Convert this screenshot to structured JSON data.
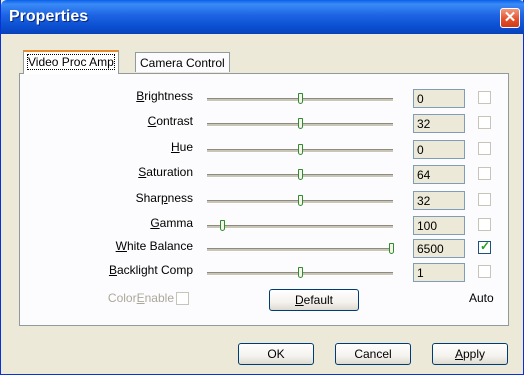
{
  "window": {
    "title": "Properties"
  },
  "tabs": [
    {
      "label": "Video Proc Amp",
      "active": true
    },
    {
      "label": "Camera Control",
      "active": false
    }
  ],
  "controls": [
    {
      "pre": "",
      "ul": "B",
      "post": "rightness",
      "value": "0",
      "level": 0.5,
      "auto": false,
      "auto_enabled": false
    },
    {
      "pre": "",
      "ul": "C",
      "post": "ontrast",
      "value": "32",
      "level": 0.5,
      "auto": false,
      "auto_enabled": false
    },
    {
      "pre": "",
      "ul": "H",
      "post": "ue",
      "value": "0",
      "level": 0.5,
      "auto": false,
      "auto_enabled": false
    },
    {
      "pre": "",
      "ul": "S",
      "post": "aturation",
      "value": "64",
      "level": 0.5,
      "auto": false,
      "auto_enabled": false
    },
    {
      "pre": "Shar",
      "ul": "p",
      "post": "ness",
      "value": "32",
      "level": 0.5,
      "auto": false,
      "auto_enabled": false
    },
    {
      "pre": "",
      "ul": "G",
      "post": "amma",
      "value": "100",
      "level": 0.08,
      "auto": false,
      "auto_enabled": false
    },
    {
      "pre": "",
      "ul": "W",
      "post": "hite Balance",
      "value": "6500",
      "level": 0.99,
      "auto": true,
      "auto_enabled": true
    },
    {
      "pre": "",
      "ul": "B",
      "post": "acklight Comp",
      "value": "1",
      "level": 0.5,
      "auto": false,
      "auto_enabled": false
    }
  ],
  "color_enable": {
    "pre": "Color",
    "ul": "E",
    "post": "nable",
    "checked": false
  },
  "default_button": {
    "ul": "D",
    "post": "efault"
  },
  "auto_label": "Auto",
  "footer": {
    "ok": "OK",
    "cancel": "Cancel",
    "apply_ul": "A",
    "apply_post": "pply"
  },
  "colors": {
    "titlebar": "#0a4ed0",
    "accent_tab": "#e68b2c",
    "check": "#21a121",
    "thumb_border": "#2f8c2f"
  }
}
